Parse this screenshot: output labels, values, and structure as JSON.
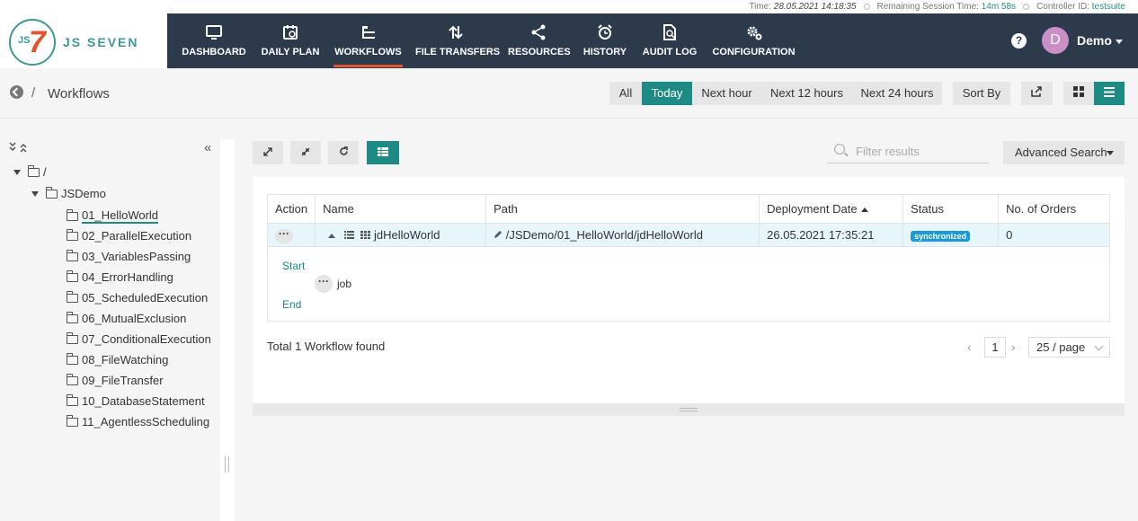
{
  "status_bar": {
    "time_label": "Time:",
    "time_value": "28.05.2021 14:18:35",
    "session_label": "Remaining Session Time:",
    "session_value": "14m 58s",
    "controller_label": "Controller ID:",
    "controller_value": "testsuite"
  },
  "logo": {
    "badge": "JS",
    "digit": "7",
    "text": "JS SEVEN"
  },
  "nav": {
    "items": [
      {
        "label": "DASHBOARD",
        "icon": "monitor-icon"
      },
      {
        "label": "DAILY PLAN",
        "icon": "calendar-icon"
      },
      {
        "label": "WORKFLOWS",
        "icon": "workflow-icon",
        "active": true
      },
      {
        "label": "FILE TRANSFERS",
        "icon": "transfer-arrows-icon"
      },
      {
        "label": "RESOURCES",
        "icon": "share-icon"
      },
      {
        "label": "HISTORY",
        "icon": "alarm-clock-icon"
      },
      {
        "label": "AUDIT LOG",
        "icon": "audit-search-icon"
      },
      {
        "label": "CONFIGURATION",
        "icon": "gears-icon"
      }
    ],
    "help": "?",
    "avatar_initial": "D",
    "user": "Demo"
  },
  "breadcrumb": {
    "separator": "/",
    "title": "Workflows"
  },
  "filters": {
    "all": "All",
    "today": "Today",
    "next_hour": "Next hour",
    "next_12": "Next 12 hours",
    "next_24": "Next 24 hours",
    "sort_by": "Sort By",
    "active_filter": "Today"
  },
  "tree": {
    "expand_all": "»»",
    "collapse_panel": "«",
    "root": "/",
    "folder": "JSDemo",
    "items": [
      "01_HelloWorld",
      "02_ParallelExecution",
      "03_VariablesPassing",
      "04_ErrorHandling",
      "05_ScheduledExecution",
      "06_MutualExclusion",
      "07_ConditionalExecution",
      "08_FileWatching",
      "09_FileTransfer",
      "10_DatabaseStatement",
      "11_AgentlessScheduling"
    ],
    "selected": "01_HelloWorld"
  },
  "toolbar": {
    "search_placeholder": "Filter results",
    "advanced_search": "Advanced Search"
  },
  "table": {
    "headers": [
      "Action",
      "Name",
      "Path",
      "Deployment Date",
      "Status",
      "No. of Orders"
    ],
    "rows": [
      {
        "name": "jdHelloWorld",
        "path": "/JSDemo/01_HelloWorld/jdHelloWorld",
        "deployment_date": "26.05.2021 17:35:21",
        "status": "synchronized",
        "orders": "0"
      }
    ]
  },
  "detail": {
    "start": "Start",
    "job": "job",
    "end": "End"
  },
  "footer": {
    "total": "Total 1 Workflow found",
    "page": "1",
    "page_size": "25 / page"
  },
  "colors": {
    "nav_bg": "#2d3a4b",
    "accent": "#1d8a84",
    "active_underline": "#e2542d",
    "badge": "#1a9bd7"
  }
}
